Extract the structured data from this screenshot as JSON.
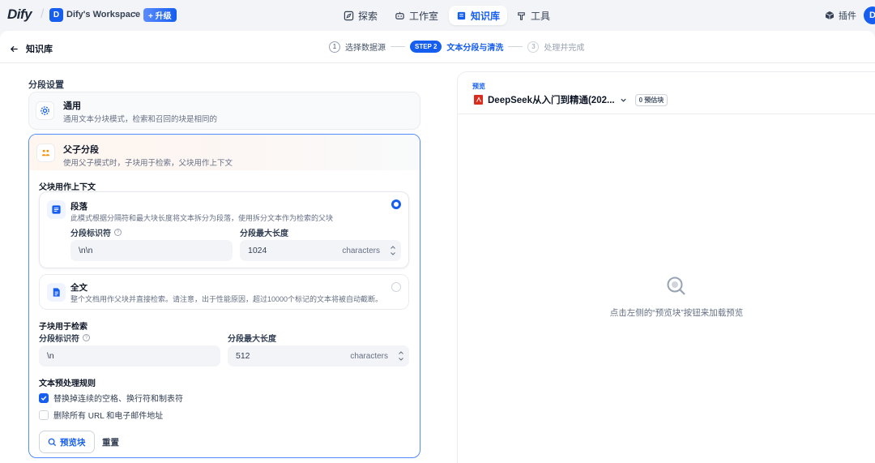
{
  "topbar": {
    "logo": "Dify",
    "workspace_initial": "D",
    "workspace_name": "Dify's Workspace",
    "upgrade_label": "+ 升级",
    "nav": [
      {
        "label": "探索",
        "icon": "compass-icon"
      },
      {
        "label": "工作室",
        "icon": "robot-icon"
      },
      {
        "label": "知识库",
        "icon": "book-icon",
        "active": true
      },
      {
        "label": "工具",
        "icon": "hammer-icon"
      }
    ],
    "plugin_label": "插件",
    "user_initial": "D"
  },
  "subheader": {
    "back_label": "知识库",
    "steps": {
      "step1_num": "1",
      "step1_label": "选择数据源",
      "step2_pill": "STEP 2",
      "step2_label": "文本分段与清洗",
      "step3_num": "3",
      "step3_label": "处理并完成"
    }
  },
  "segment": {
    "title": "分段设置",
    "general": {
      "title": "通用",
      "desc": "通用文本分块模式，检索和召回的块是相同的"
    },
    "parent_child": {
      "title": "父子分段",
      "desc": "使用父子模式时，子块用于检索，父块用作上下文",
      "parent_context_title": "父块用作上下文",
      "paragraph": {
        "title": "段落",
        "desc": "此模式根据分隔符和最大块长度将文本拆分为段落，使用拆分文本作为检索的父块",
        "delimiter_label": "分段标识符",
        "delimiter_value": "\\n\\n",
        "maxlen_label": "分段最大长度",
        "maxlen_value": "1024",
        "unit": "characters"
      },
      "fulltext": {
        "title": "全文",
        "desc": "整个文档用作父块并直接检索。请注意，出于性能原因，超过10000个标记的文本将被自动截断。"
      },
      "child_title": "子块用于检索",
      "child": {
        "delimiter_label": "分段标识符",
        "delimiter_value": "\\n",
        "maxlen_label": "分段最大长度",
        "maxlen_value": "512",
        "unit": "characters"
      },
      "preprocess_title": "文本预处理规则",
      "rules": [
        {
          "label": "替换掉连续的空格、换行符和制表符",
          "checked": true
        },
        {
          "label": "删除所有 URL 和电子邮件地址",
          "checked": false
        }
      ],
      "preview_button": "预览块",
      "reset_button": "重置"
    }
  },
  "preview": {
    "label": "预览",
    "doc_name": "DeepSeek从入门到精通(202...",
    "badge": "0 预估块",
    "empty_text": "点击左侧的“预览块”按钮来加载预览"
  },
  "colors": {
    "accent": "#155eef",
    "orange": "#f79009",
    "pdf_red": "#d92d20"
  }
}
